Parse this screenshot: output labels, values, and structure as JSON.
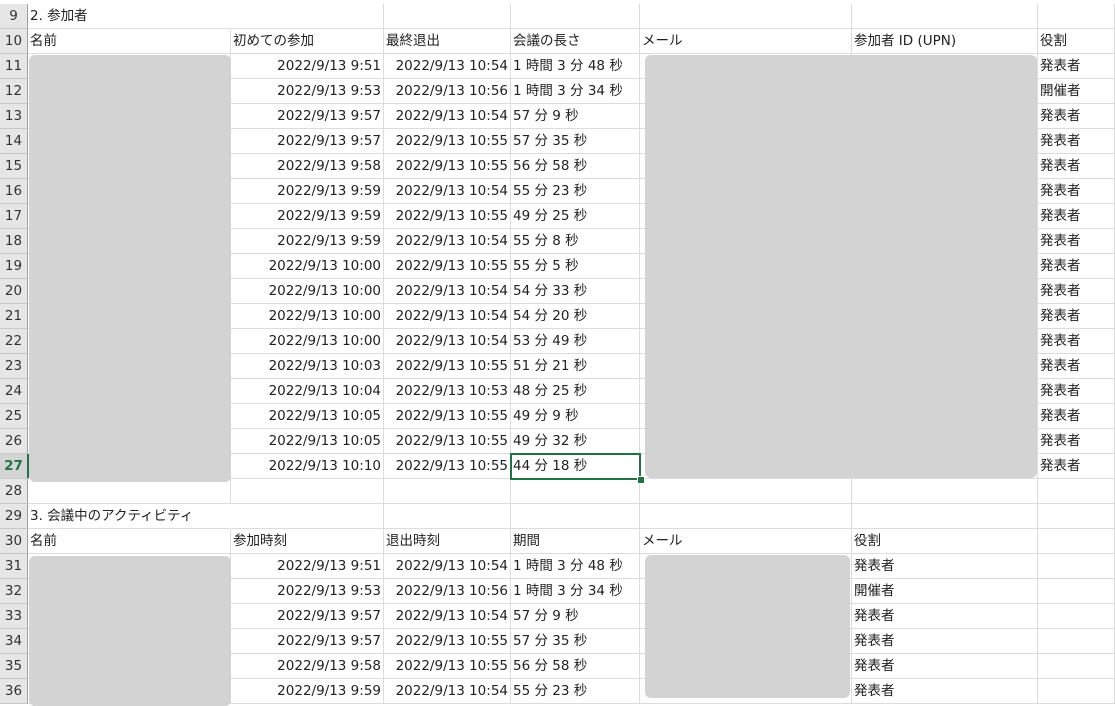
{
  "section2": {
    "title": "2. 参加者",
    "headers": [
      "名前",
      "初めての参加",
      "最終退出",
      "会議の長さ",
      "メール",
      "参加者 ID (UPN)",
      "役割"
    ],
    "rows": [
      {
        "row": "11",
        "first": "2022/9/13 9:51",
        "last": "2022/9/13 10:54",
        "dur": "1 時間 3 分 48 秒",
        "role": "発表者"
      },
      {
        "row": "12",
        "first": "2022/9/13 9:53",
        "last": "2022/9/13 10:56",
        "dur": "1 時間 3 分 34 秒",
        "role": "開催者"
      },
      {
        "row": "13",
        "first": "2022/9/13 9:57",
        "last": "2022/9/13 10:54",
        "dur": "57 分 9 秒",
        "role": "発表者"
      },
      {
        "row": "14",
        "first": "2022/9/13 9:57",
        "last": "2022/9/13 10:55",
        "dur": "57 分 35 秒",
        "role": "発表者"
      },
      {
        "row": "15",
        "first": "2022/9/13 9:58",
        "last": "2022/9/13 10:55",
        "dur": "56 分 58 秒",
        "role": "発表者"
      },
      {
        "row": "16",
        "first": "2022/9/13 9:59",
        "last": "2022/9/13 10:54",
        "dur": "55 分 23 秒",
        "role": "発表者"
      },
      {
        "row": "17",
        "first": "2022/9/13 9:59",
        "last": "2022/9/13 10:55",
        "dur": "49 分 25 秒",
        "role": "発表者"
      },
      {
        "row": "18",
        "first": "2022/9/13 9:59",
        "last": "2022/9/13 10:54",
        "dur": "55 分 8 秒",
        "role": "発表者"
      },
      {
        "row": "19",
        "first": "2022/9/13 10:00",
        "last": "2022/9/13 10:55",
        "dur": "55 分 5 秒",
        "role": "発表者"
      },
      {
        "row": "20",
        "first": "2022/9/13 10:00",
        "last": "2022/9/13 10:54",
        "dur": "54 分 33 秒",
        "role": "発表者"
      },
      {
        "row": "21",
        "first": "2022/9/13 10:00",
        "last": "2022/9/13 10:54",
        "dur": "54 分 20 秒",
        "role": "発表者"
      },
      {
        "row": "22",
        "first": "2022/9/13 10:00",
        "last": "2022/9/13 10:54",
        "dur": "53 分 49 秒",
        "role": "発表者"
      },
      {
        "row": "23",
        "first": "2022/9/13 10:03",
        "last": "2022/9/13 10:55",
        "dur": "51 分 21 秒",
        "role": "発表者"
      },
      {
        "row": "24",
        "first": "2022/9/13 10:04",
        "last": "2022/9/13 10:53",
        "dur": "48 分 25 秒",
        "role": "発表者"
      },
      {
        "row": "25",
        "first": "2022/9/13 10:05",
        "last": "2022/9/13 10:55",
        "dur": "49 分 9 秒",
        "role": "発表者"
      },
      {
        "row": "26",
        "first": "2022/9/13 10:05",
        "last": "2022/9/13 10:55",
        "dur": "49 分 32 秒",
        "role": "発表者"
      },
      {
        "row": "27",
        "first": "2022/9/13 10:10",
        "last": "2022/9/13 10:55",
        "dur": "44 分 18 秒",
        "role": "発表者"
      }
    ]
  },
  "section3": {
    "title": "3. 会議中のアクティビティ",
    "headers": [
      "名前",
      "参加時刻",
      "退出時刻",
      "期間",
      "メール",
      "役割"
    ],
    "rows": [
      {
        "row": "31",
        "first": "2022/9/13 9:51",
        "last": "2022/9/13 10:54",
        "dur": "1 時間 3 分 48 秒",
        "role": "発表者"
      },
      {
        "row": "32",
        "first": "2022/9/13 9:53",
        "last": "2022/9/13 10:56",
        "dur": "1 時間 3 分 34 秒",
        "role": "開催者"
      },
      {
        "row": "33",
        "first": "2022/9/13 9:57",
        "last": "2022/9/13 10:54",
        "dur": "57 分 9 秒",
        "role": "発表者"
      },
      {
        "row": "34",
        "first": "2022/9/13 9:57",
        "last": "2022/9/13 10:55",
        "dur": "57 分 35 秒",
        "role": "発表者"
      },
      {
        "row": "35",
        "first": "2022/9/13 9:58",
        "last": "2022/9/13 10:55",
        "dur": "56 分 58 秒",
        "role": "発表者"
      },
      {
        "row": "36",
        "first": "2022/9/13 9:59",
        "last": "2022/9/13 10:54",
        "dur": "55 分 23 秒",
        "role": "発表者"
      }
    ]
  },
  "row_numbers": {
    "r9": "9",
    "r10": "10",
    "r28": "28",
    "r29": "29",
    "r30": "30"
  },
  "active_row": "27",
  "colors": {
    "selection": "#217346",
    "redaction": "#d3d3d3",
    "header_bg": "#e6e6e6"
  }
}
